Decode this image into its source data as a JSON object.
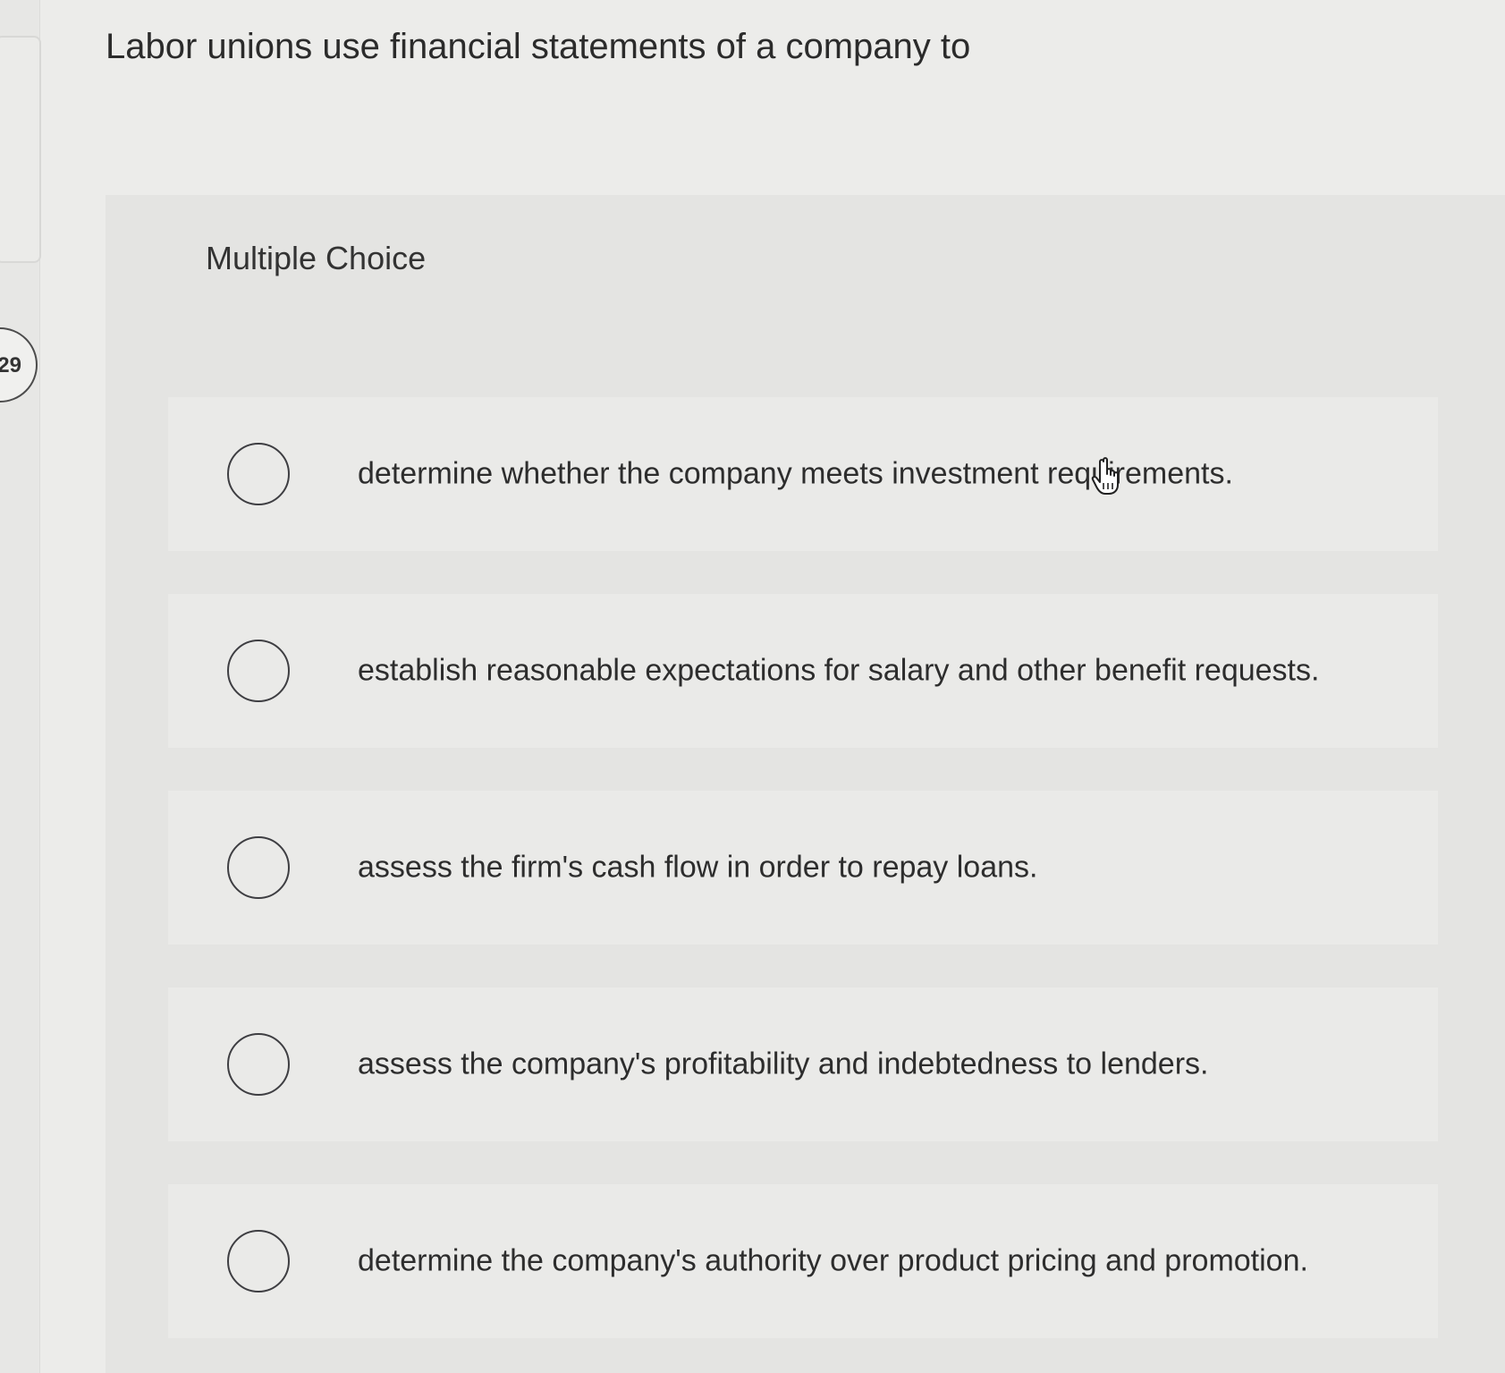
{
  "sidebar": {
    "question_number": "29"
  },
  "question": {
    "stem": "Labor unions use financial statements of a company to",
    "type_label": "Multiple Choice",
    "options": [
      {
        "label": "determine whether the company meets investment requirements."
      },
      {
        "label": "establish reasonable expectations for salary and other benefit requests."
      },
      {
        "label": "assess the firm's cash flow in order to repay loans."
      },
      {
        "label": "assess the company's profitability and indebtedness to lenders."
      },
      {
        "label": "determine the company's authority over product pricing and promotion."
      }
    ]
  },
  "cursor": {
    "icon": "hand-pointer-icon"
  }
}
